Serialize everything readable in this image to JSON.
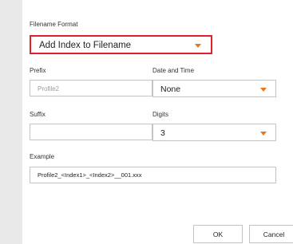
{
  "filename_format": {
    "label": "Filename Format",
    "selected": "Add Index to Filename"
  },
  "prefix": {
    "label": "Prefix",
    "value": "Profile2"
  },
  "date_time": {
    "label": "Date and Time",
    "selected": "None"
  },
  "suffix": {
    "label": "Suffix",
    "value": ""
  },
  "digits": {
    "label": "Digits",
    "selected": "3"
  },
  "example": {
    "label": "Example",
    "value": "Profile2_<Index1>_<Index2>__001.xxx"
  },
  "buttons": {
    "ok": "OK",
    "cancel": "Cancel"
  },
  "colors": {
    "highlight_border": "#e0202a",
    "caret": "#e8761c"
  }
}
